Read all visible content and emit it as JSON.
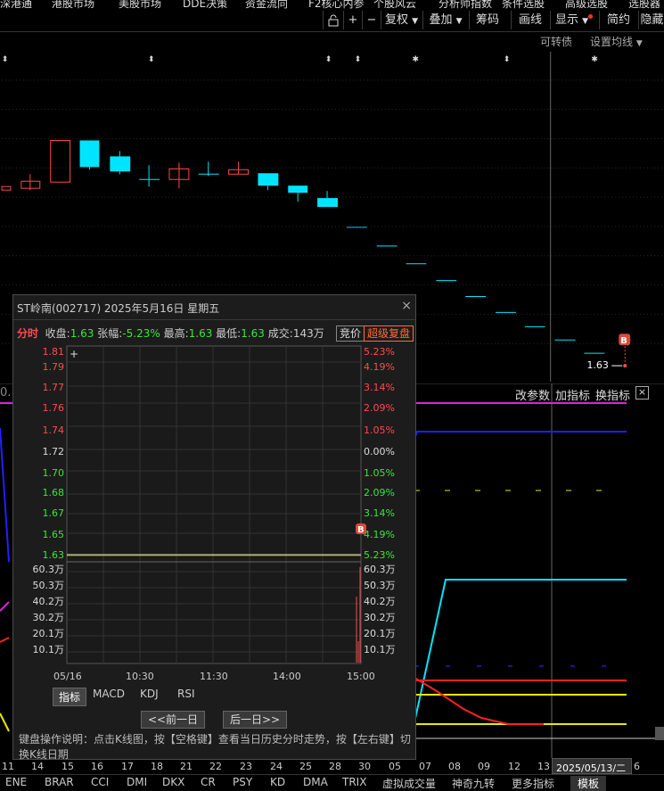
{
  "top_menu": [
    "深港通",
    "港股市场",
    "美股市场",
    "DDE决策",
    "资金流向",
    "F2核心内参",
    "个股风云",
    "分析师指数",
    "条件选股",
    "高级选股",
    "选股器"
  ],
  "toolbar": {
    "items": [
      "+",
      "−",
      "复权",
      "叠加",
      "筹码",
      "画线",
      "显示",
      "简约",
      "隐藏"
    ]
  },
  "subbar": {
    "convertible": "可转债",
    "set_ma": "设置均线"
  },
  "main_chart": {
    "last_price_label": "1.63",
    "b_marker": "B"
  },
  "lower_panel": {
    "change_params": "改参数",
    "add_indicator": "加指标",
    "switch_indicator": "换指标",
    "left_label": "0."
  },
  "date_axis": {
    "labels": [
      "11",
      "14",
      "15",
      "16",
      "17",
      "18",
      "21",
      "22",
      "23",
      "24",
      "25",
      "28",
      "30",
      "05",
      "07",
      "08",
      "09",
      "12",
      "13"
    ],
    "highlight": "2025/05/13/二",
    "last": "6"
  },
  "bottom_tabs": {
    "items": [
      "ENE",
      "BRAR",
      "CCI",
      "DMI",
      "DKX",
      "CR",
      "PSY",
      "KD",
      "DMA",
      "TRIX",
      "虚拟成交量",
      "神奇九转",
      "更多指标",
      "模板"
    ],
    "active": "模板"
  },
  "popup": {
    "title": "ST岭南(002717) 2025年5月16日 星期五",
    "close": "×",
    "tab": "分时",
    "close_label": "收盘:",
    "close_value": "1.63",
    "change_label": "张幅:",
    "change_value": "-5.23%",
    "high_label": "最高:",
    "high_value": "1.63",
    "low_label": "最低:",
    "low_value": "1.63",
    "volume_label": "成交:",
    "volume_value": "143万",
    "auction_btn": "竞价",
    "super_btn": "超级复盘",
    "price_axis_left": [
      "1.81",
      "1.79",
      "1.77",
      "1.76",
      "1.74",
      "1.72",
      "1.70",
      "1.68",
      "1.67",
      "1.65",
      "1.63"
    ],
    "price_axis_right": [
      "5.23%",
      "4.19%",
      "3.14%",
      "2.09%",
      "1.05%",
      "0.00%",
      "1.05%",
      "2.09%",
      "3.14%",
      "4.19%",
      "5.23%"
    ],
    "volume_axis": [
      "60.3万",
      "50.3万",
      "40.2万",
      "30.2万",
      "20.1万",
      "10.1万"
    ],
    "time_axis": [
      "05/16",
      "10:30",
      "11:30",
      "14:00",
      "15:00"
    ],
    "indicator_tabs": [
      "指标",
      "MACD",
      "KDJ",
      "RSI"
    ],
    "active_indicator": "指标",
    "prev_day": "<<前一日",
    "next_day": "后一日>>",
    "help_text": "键盘操作说明：点击K线图，按【空格键】查看当日历史分时走势，按【左右键】切换K线日期",
    "b_marker": "B",
    "crosshair": "+"
  },
  "colors": {
    "up": "#ff4a4a",
    "down": "#00e5ff",
    "ma_yellow": "#e8e800",
    "magenta": "#e020e0",
    "blue": "#2020ff"
  }
}
